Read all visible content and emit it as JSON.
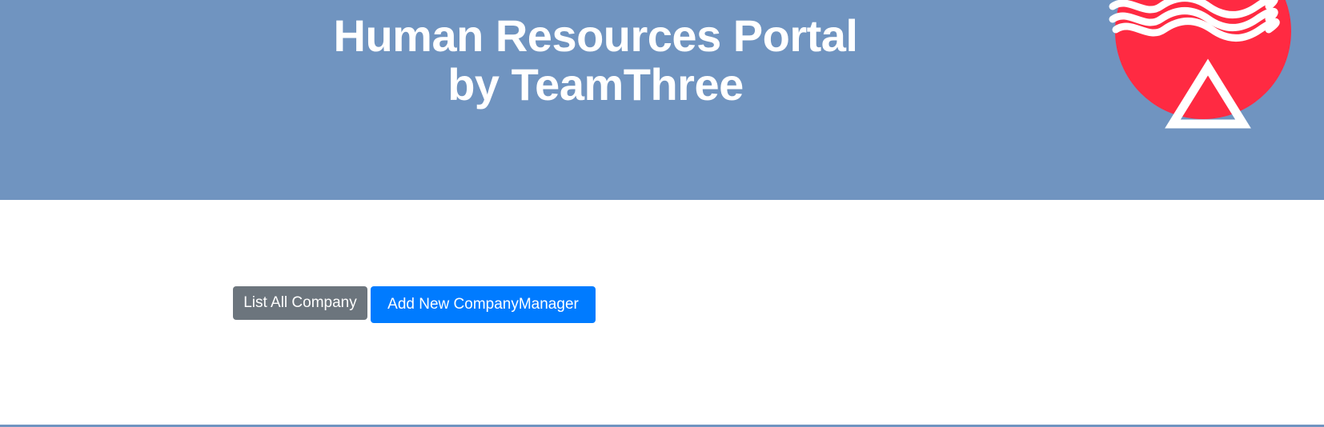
{
  "header": {
    "title_line1": "Human Resources Portal",
    "title_line2": "by TeamThree",
    "background_color": "#7094c0",
    "logo_icon": "waves-circle-triangle-logo",
    "logo_circle_color": "#ff2a42"
  },
  "actions": {
    "list_companies_label": "List All Company",
    "add_manager_label": "Add New CompanyManager",
    "secondary_color": "#6c757d",
    "primary_color": "#007bff"
  }
}
